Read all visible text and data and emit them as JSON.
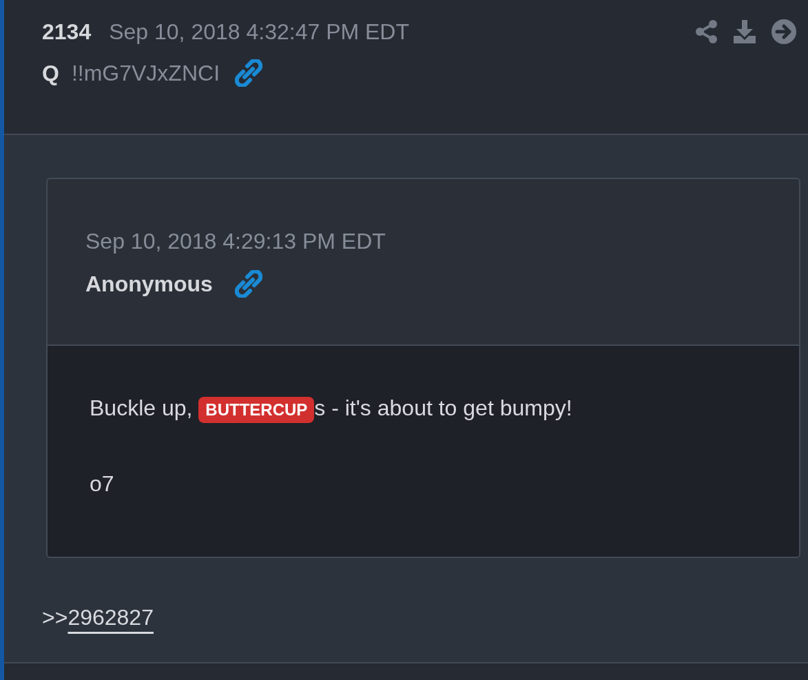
{
  "post": {
    "number": "2134",
    "timestamp": "Sep 10, 2018 4:32:47 PM EDT",
    "author": "Q",
    "tripcode": "!!mG7VJxZNCI"
  },
  "quote": {
    "timestamp": "Sep 10, 2018 4:29:13 PM EDT",
    "author": "Anonymous",
    "lines": [
      {
        "kind": "badge",
        "before": "Buckle up, ",
        "badge": "BUTTERCUP",
        "after": "s - it's about to get bumpy!"
      },
      {
        "kind": "text",
        "text": "o7"
      }
    ]
  },
  "reply_link": {
    "prefix": ">>",
    "number": "2962827"
  }
}
